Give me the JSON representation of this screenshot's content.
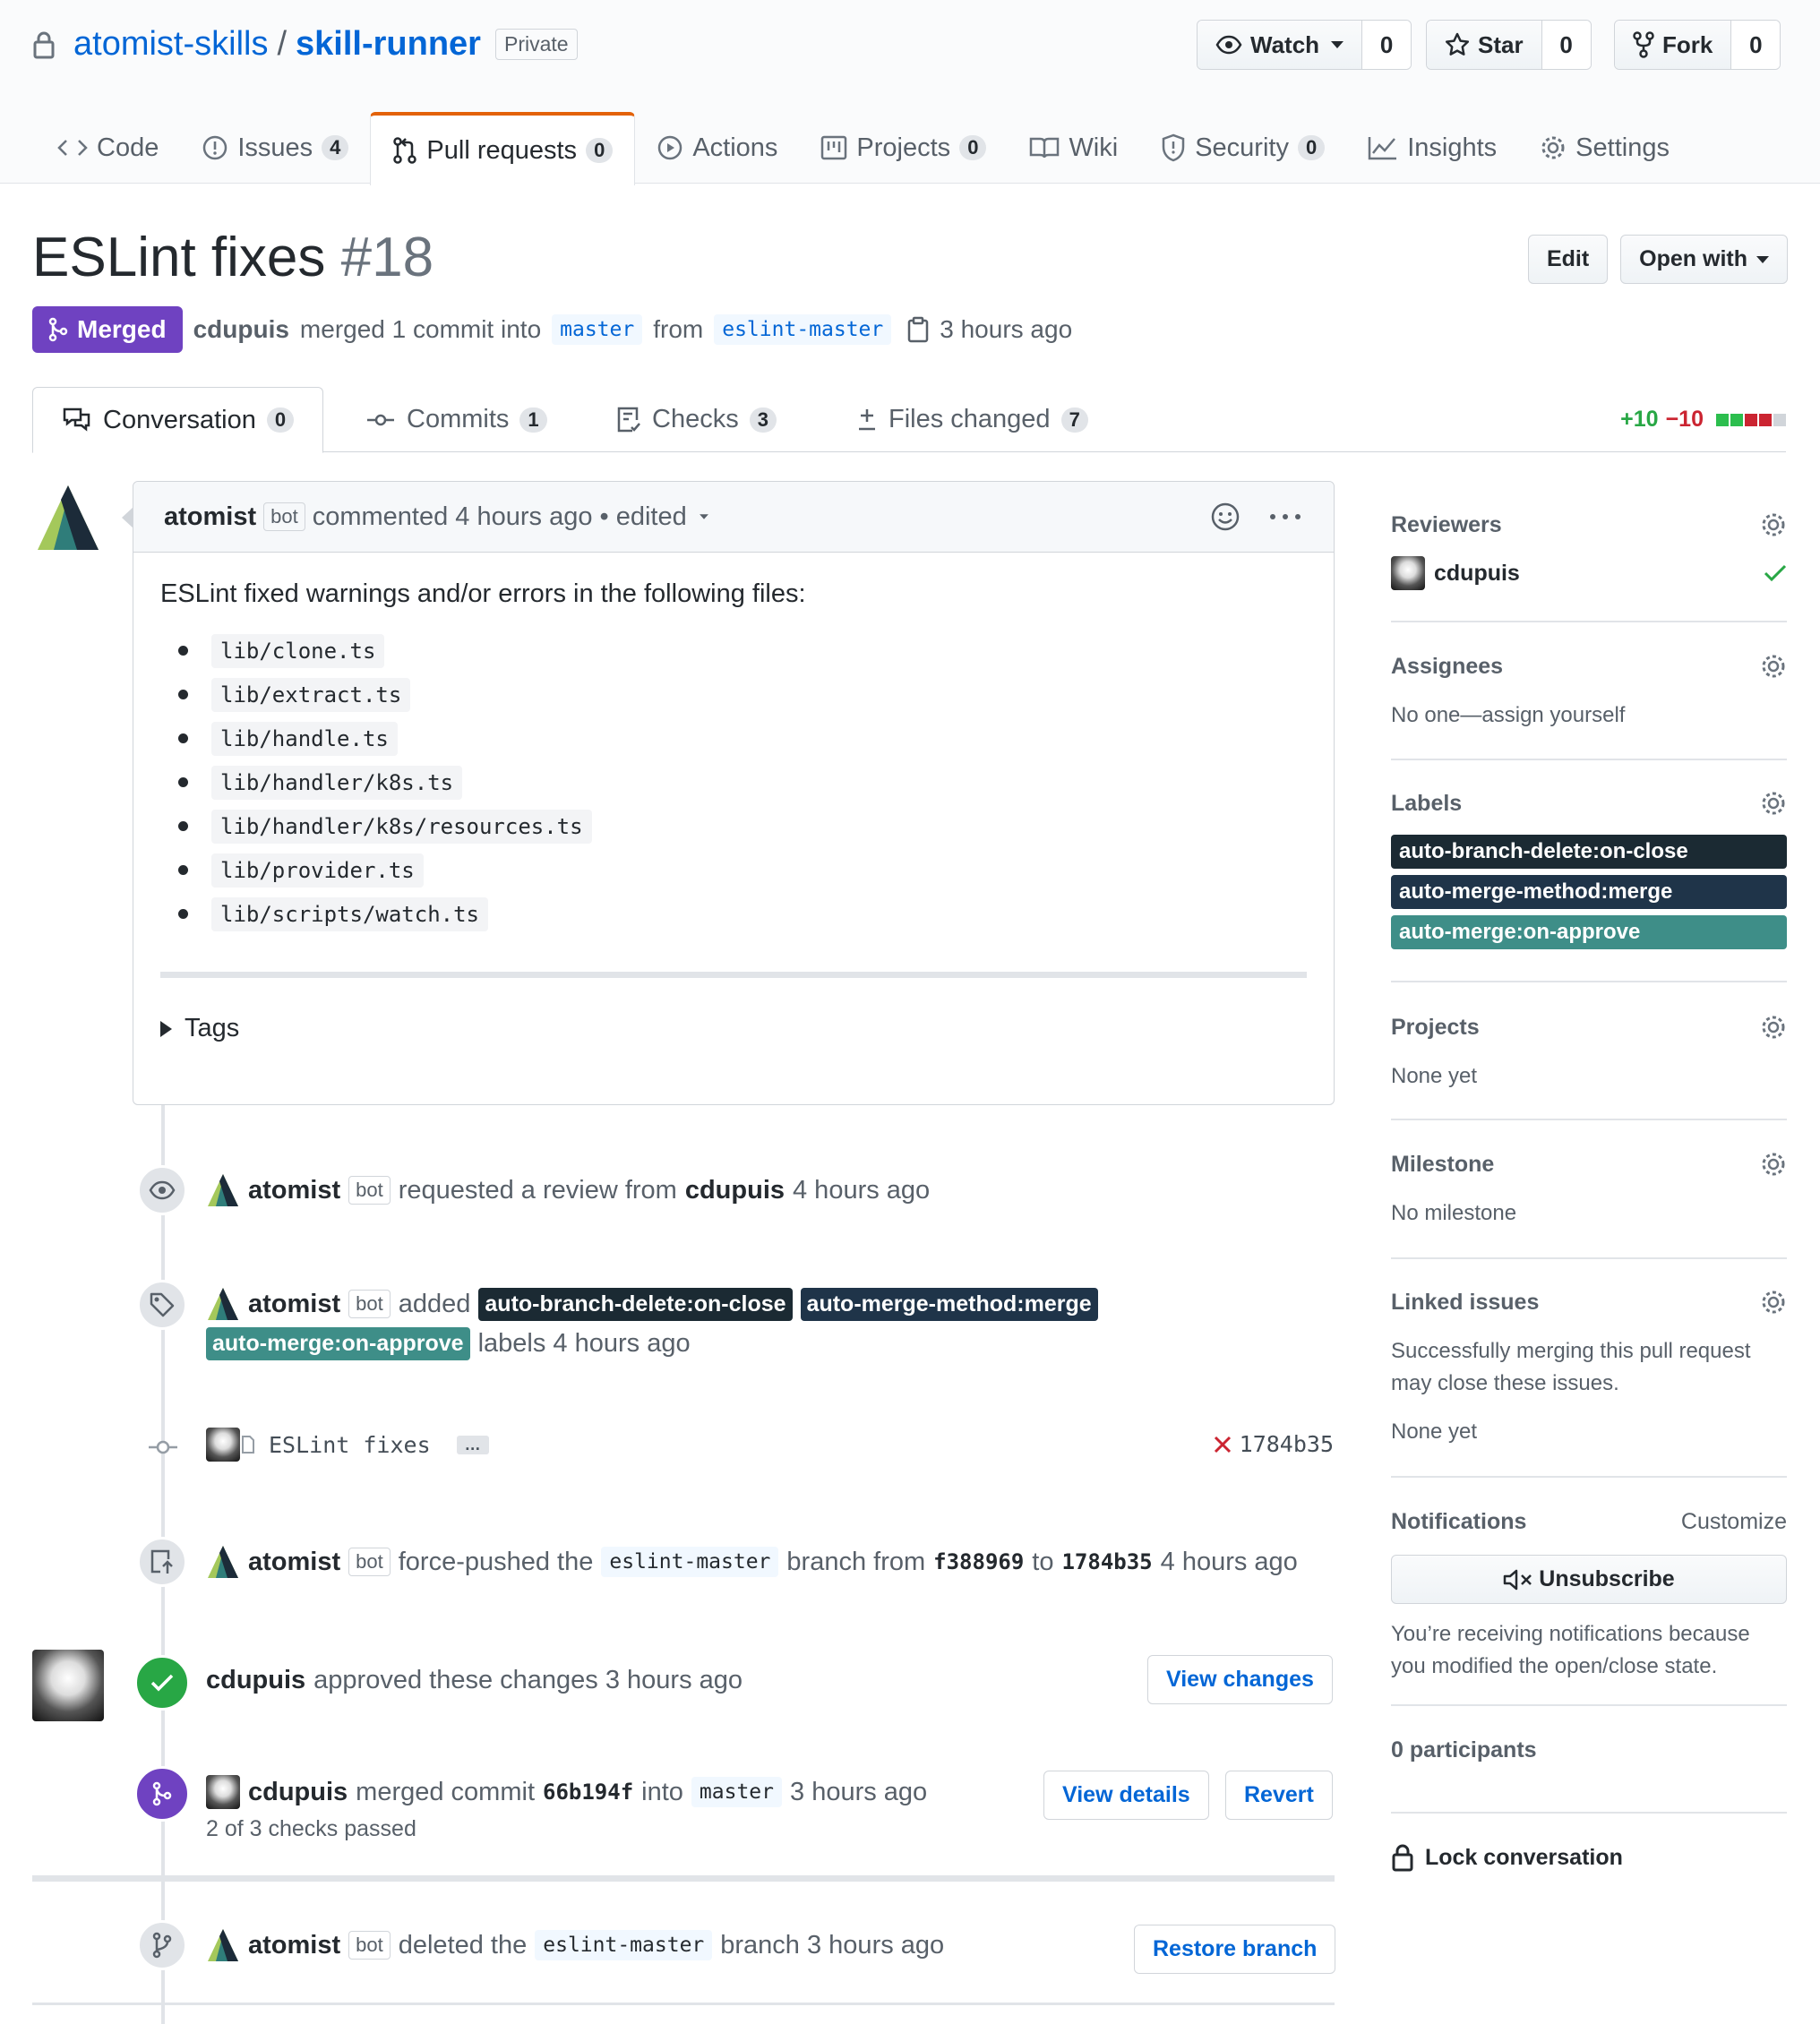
{
  "repo": {
    "owner": "atomist-skills",
    "name": "skill-runner",
    "visibility": "Private"
  },
  "actions": {
    "watch": "Watch",
    "watch_count": "0",
    "star": "Star",
    "star_count": "0",
    "fork": "Fork",
    "fork_count": "0"
  },
  "nav": [
    {
      "label": "Code",
      "count": ""
    },
    {
      "label": "Issues",
      "count": "4"
    },
    {
      "label": "Pull requests",
      "count": "0"
    },
    {
      "label": "Actions",
      "count": ""
    },
    {
      "label": "Projects",
      "count": "0"
    },
    {
      "label": "Wiki",
      "count": ""
    },
    {
      "label": "Security",
      "count": "0"
    },
    {
      "label": "Insights",
      "count": ""
    },
    {
      "label": "Settings",
      "count": ""
    }
  ],
  "pr": {
    "title": "ESLint fixes",
    "number": "#18",
    "state": "Merged",
    "author": "cdupuis",
    "merge_text": "merged 1 commit into",
    "base": "master",
    "from": "from",
    "head": "eslint-master",
    "time": "3 hours ago",
    "edit": "Edit",
    "open_with": "Open with"
  },
  "prtabs": [
    {
      "label": "Conversation",
      "count": "0"
    },
    {
      "label": "Commits",
      "count": "1"
    },
    {
      "label": "Checks",
      "count": "3"
    },
    {
      "label": "Files changed",
      "count": "7"
    }
  ],
  "diffstat": {
    "add": "+10",
    "del": "−10",
    "colors": [
      "#2cbe4e",
      "#2cbe4e",
      "#cb2431",
      "#cb2431",
      "#d1d5da"
    ]
  },
  "comment": {
    "author": "atomist",
    "bot": "bot",
    "action": "commented 4 hours ago",
    "edited": "• edited",
    "intro": "ESLint fixed warnings and/or errors in the following files:",
    "files": [
      "lib/clone.ts",
      "lib/extract.ts",
      "lib/handle.ts",
      "lib/handler/k8s.ts",
      "lib/handler/k8s/resources.ts",
      "lib/provider.ts",
      "lib/scripts/watch.ts"
    ],
    "tags": "Tags"
  },
  "timeline": {
    "review": {
      "author": "atomist",
      "bot": "bot",
      "text": "requested a review from",
      "target": "cdupuis",
      "time": "4 hours ago"
    },
    "labels": {
      "author": "atomist",
      "bot": "bot",
      "text": "added",
      "labels": [
        "auto-branch-delete:on-close",
        "auto-merge-method:merge",
        "auto-merge:on-approve"
      ],
      "suffix": "labels 4 hours ago"
    },
    "commit": {
      "message": "ESLint fixes",
      "more": "…",
      "sha": "1784b35"
    },
    "force": {
      "author": "atomist",
      "bot": "bot",
      "text": "force-pushed the",
      "branch": "eslint-master",
      "mid": "branch from",
      "from": "f388969",
      "to_word": "to",
      "to": "1784b35",
      "time": "4 hours ago"
    },
    "approved": {
      "author": "cdupuis",
      "text": "approved these changes 3 hours ago",
      "button": "View changes"
    },
    "merged": {
      "author": "cdupuis",
      "text": "merged commit",
      "sha": "66b194f",
      "into": "into",
      "branch": "master",
      "time": "3 hours ago",
      "checks": "2 of 3 checks passed",
      "details": "View details",
      "revert": "Revert"
    },
    "deleted": {
      "author": "atomist",
      "bot": "bot",
      "text": "deleted the",
      "branch": "eslint-master",
      "suffix": "branch 3 hours ago",
      "button": "Restore branch"
    }
  },
  "label_colors": {
    "auto-branch-delete:on-close": "#1b2a33",
    "auto-merge-method:merge": "#1f3449",
    "auto-merge:on-approve": "#3e8e88"
  },
  "sidebar": {
    "reviewers": {
      "title": "Reviewers",
      "name": "cdupuis"
    },
    "assignees": {
      "title": "Assignees",
      "value": "No one—assign yourself"
    },
    "labels": {
      "title": "Labels",
      "items": [
        "auto-branch-delete:on-close",
        "auto-merge-method:merge",
        "auto-merge:on-approve"
      ]
    },
    "projects": {
      "title": "Projects",
      "value": "None yet"
    },
    "milestone": {
      "title": "Milestone",
      "value": "No milestone"
    },
    "linked": {
      "title": "Linked issues",
      "value": "Successfully merging this pull request may close these issues.",
      "none": "None yet"
    },
    "notifications": {
      "title": "Notifications",
      "customize": "Customize",
      "button": "Unsubscribe",
      "reason": "You’re receiving notifications because you modified the open/close state."
    },
    "participants": "0 participants",
    "lock": "Lock conversation"
  }
}
